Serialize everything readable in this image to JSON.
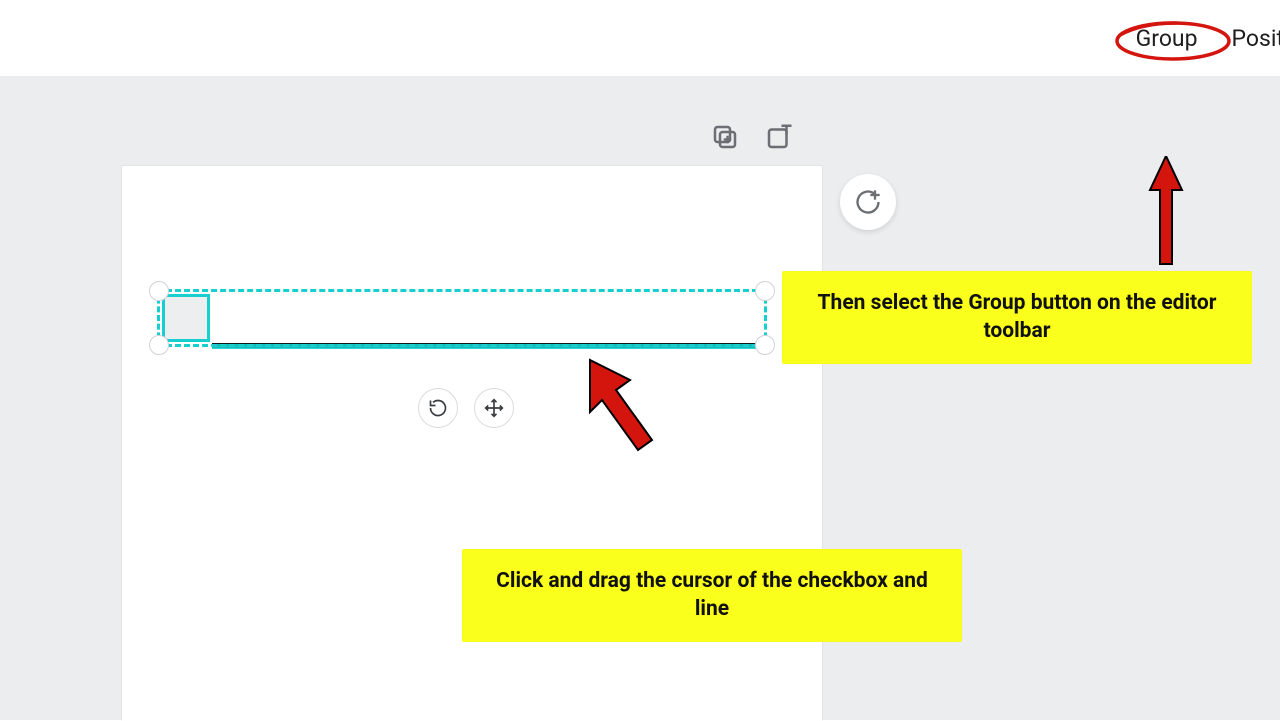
{
  "toolbar": {
    "group_label": "Group",
    "position_label": "Posit"
  },
  "callouts": {
    "top": "Then select the Group button on the editor toolbar",
    "bottom": "Click and drag the cursor of the checkbox and line"
  },
  "colors": {
    "selection": "#17cfcf",
    "callout_bg": "#faff1c",
    "arrow": "#d4150e"
  }
}
